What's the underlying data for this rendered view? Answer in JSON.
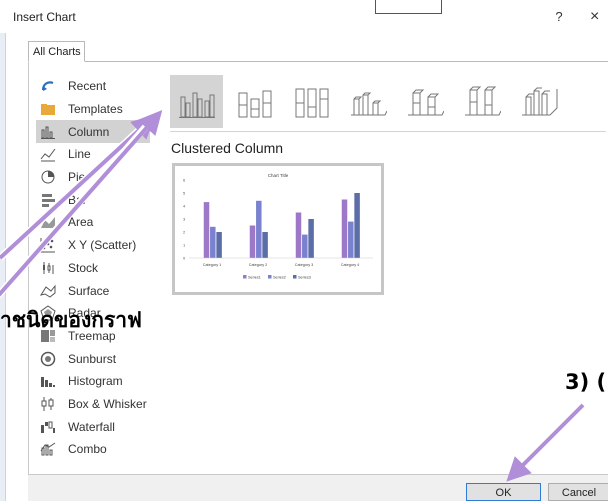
{
  "dialog": {
    "title": "Insert Chart",
    "help": "?",
    "close": "×"
  },
  "tabs": [
    "All Charts"
  ],
  "chart_types": [
    {
      "label": "Recent",
      "icon": "recent-icon"
    },
    {
      "label": "Templates",
      "icon": "folder-icon"
    },
    {
      "label": "Column",
      "icon": "column-chart-icon",
      "selected": true
    },
    {
      "label": "Line",
      "icon": "line-chart-icon"
    },
    {
      "label": "Pie",
      "icon": "pie-chart-icon"
    },
    {
      "label": "Bar",
      "icon": "bar-chart-icon"
    },
    {
      "label": "Area",
      "icon": "area-chart-icon"
    },
    {
      "label": "X Y (Scatter)",
      "icon": "scatter-chart-icon"
    },
    {
      "label": "Stock",
      "icon": "stock-chart-icon"
    },
    {
      "label": "Surface",
      "icon": "surface-chart-icon"
    },
    {
      "label": "Radar",
      "icon": "radar-chart-icon"
    },
    {
      "label": "Treemap",
      "icon": "treemap-chart-icon"
    },
    {
      "label": "Sunburst",
      "icon": "sunburst-chart-icon"
    },
    {
      "label": "Histogram",
      "icon": "histogram-chart-icon"
    },
    {
      "label": "Box & Whisker",
      "icon": "box-whisker-chart-icon"
    },
    {
      "label": "Waterfall",
      "icon": "waterfall-chart-icon"
    },
    {
      "label": "Combo",
      "icon": "combo-chart-icon"
    }
  ],
  "subtypes": [
    "Clustered Column",
    "Stacked Column",
    "100% Stacked Column",
    "3-D Clustered Column",
    "3-D Stacked Column",
    "3-D 100% Stacked Column",
    "3-D Column"
  ],
  "selected_subtype_name": "Clustered Column",
  "preview": {
    "chart_title": "Chart Title",
    "chart_data": {
      "type": "bar",
      "title": "Chart Title",
      "categories": [
        "Category 1",
        "Category 2",
        "Category 3",
        "Category 4"
      ],
      "series": [
        {
          "name": "Series1",
          "values": [
            4.3,
            2.5,
            3.5,
            4.5
          ],
          "color": "#9e78c8"
        },
        {
          "name": "Series2",
          "values": [
            2.4,
            4.4,
            1.8,
            2.8
          ],
          "color": "#7a82cf"
        },
        {
          "name": "Series3",
          "values": [
            2.0,
            2.0,
            3.0,
            5.0
          ],
          "color": "#5b6ea8"
        }
      ],
      "yticks": [
        "6",
        "5",
        "4",
        "3",
        "2",
        "1",
        "0"
      ],
      "ylim": [
        0,
        6
      ],
      "legend": "bottom"
    }
  },
  "buttons": {
    "ok": "OK",
    "cancel": "Cancel"
  },
  "annotations": {
    "select_type": "าชนิดของกราฟ",
    "step3": "3) ("
  },
  "colors": {
    "arrow": "#b08fd8",
    "selection": "#d2d2d2",
    "accent": "#2e7cd6"
  }
}
